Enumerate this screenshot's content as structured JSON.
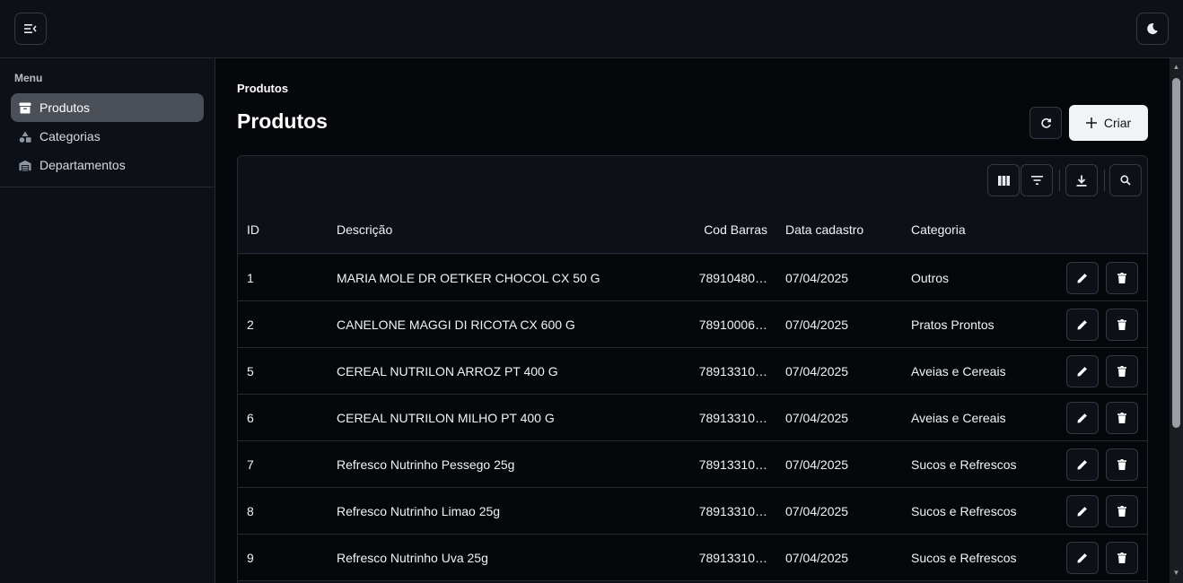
{
  "sidebar": {
    "title": "Menu",
    "items": [
      {
        "label": "Produtos",
        "icon": "archive-box-icon",
        "active": true
      },
      {
        "label": "Categorias",
        "icon": "shapes-icon",
        "active": false
      },
      {
        "label": "Departamentos",
        "icon": "warehouse-icon",
        "active": false
      }
    ]
  },
  "main": {
    "breadcrumb": "Produtos",
    "title": "Produtos",
    "create_label": "Criar"
  },
  "table": {
    "columns": [
      "ID",
      "Descrição",
      "Cod Barras",
      "Data cadastro",
      "Categoria"
    ],
    "rows": [
      {
        "id": "1",
        "desc": "MARIA MOLE DR OETKER CHOCOL CX 50 G",
        "cod": "78910480…",
        "data": "07/04/2025",
        "cat": "Outros"
      },
      {
        "id": "2",
        "desc": "CANELONE MAGGI DI RICOTA CX 600 G",
        "cod": "78910006…",
        "data": "07/04/2025",
        "cat": "Pratos Prontos"
      },
      {
        "id": "5",
        "desc": "CEREAL NUTRILON ARROZ PT 400 G",
        "cod": "78913310…",
        "data": "07/04/2025",
        "cat": "Aveias e Cereais"
      },
      {
        "id": "6",
        "desc": "CEREAL NUTRILON MILHO PT 400 G",
        "cod": "78913310…",
        "data": "07/04/2025",
        "cat": "Aveias e Cereais"
      },
      {
        "id": "7",
        "desc": "Refresco Nutrinho Pessego 25g",
        "cod": "78913310…",
        "data": "07/04/2025",
        "cat": "Sucos e Refrescos"
      },
      {
        "id": "8",
        "desc": "Refresco Nutrinho Limao 25g",
        "cod": "78913310…",
        "data": "07/04/2025",
        "cat": "Sucos e Refrescos"
      },
      {
        "id": "9",
        "desc": "Refresco Nutrinho Uva 25g",
        "cod": "78913310…",
        "data": "07/04/2025",
        "cat": "Sucos e Refrescos"
      }
    ]
  },
  "colors": {
    "background": "#05070a",
    "panel": "#0d1117",
    "border": "#262b33",
    "active_item": "#4a4f58",
    "primary_button": "#f1f3f5"
  }
}
